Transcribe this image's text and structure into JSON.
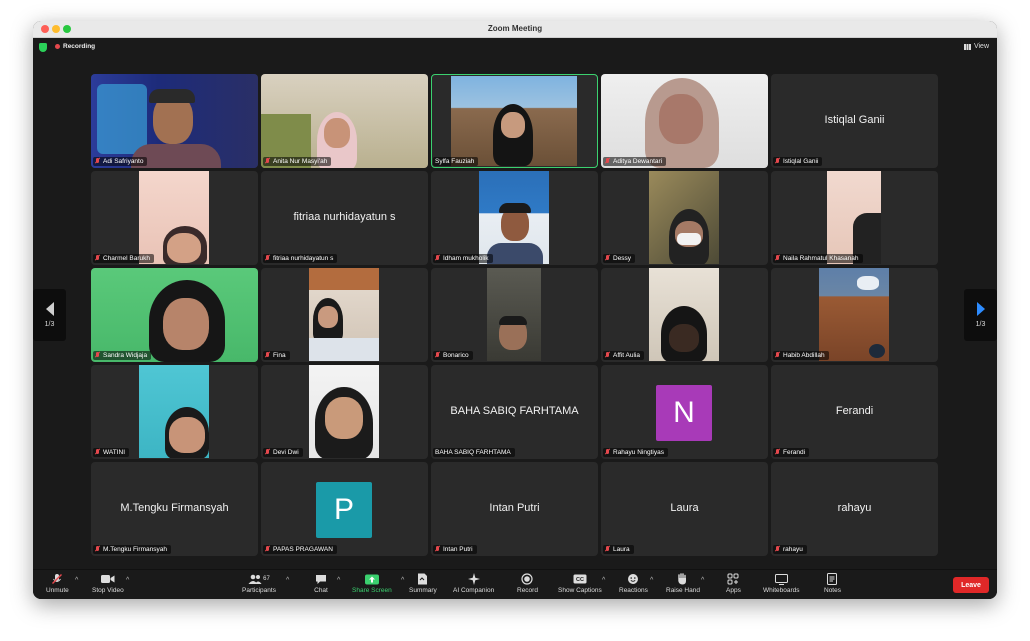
{
  "window": {
    "title": "Zoom Meeting"
  },
  "topbar": {
    "recording_label": "Recording",
    "view_label": "View"
  },
  "pager": {
    "left_label": "1/3",
    "right_label": "1/3"
  },
  "tiles": [
    {
      "name": "Adi Safriyanto",
      "big": ""
    },
    {
      "name": "Anita Nur Masyi'ah",
      "big": ""
    },
    {
      "name": "Sylfa Fauziah",
      "big": ""
    },
    {
      "name": "Aditya Dewantari",
      "big": ""
    },
    {
      "name": "Istiqlal Ganii",
      "big": "Istiqlal Ganii"
    },
    {
      "name": "Charmel Barukh",
      "big": ""
    },
    {
      "name": "fitriaa nurhidayatun s",
      "big": "fitriaa nurhidayatun s"
    },
    {
      "name": "Idham mukholik",
      "big": ""
    },
    {
      "name": "Dessy",
      "big": ""
    },
    {
      "name": "Naila Rahmatul Khasanah",
      "big": ""
    },
    {
      "name": "Sandra Widjaja",
      "big": ""
    },
    {
      "name": "Fina",
      "big": ""
    },
    {
      "name": "Bonarico",
      "big": ""
    },
    {
      "name": "Affit Aulia",
      "big": ""
    },
    {
      "name": "Habib Abdillah",
      "big": ""
    },
    {
      "name": "WATINI",
      "big": ""
    },
    {
      "name": "Devi Dwi",
      "big": ""
    },
    {
      "name": "BAHA SABIQ FARHTAMA",
      "big": "BAHA SABIQ FARHTAMA"
    },
    {
      "name": "Rahayu Ningtiyas",
      "big": "",
      "avatar_letter": "N",
      "avatar_color": "#a83ab8"
    },
    {
      "name": "Ferandi",
      "big": "Ferandi"
    },
    {
      "name": "M.Tengku Firmansyah",
      "big": "M.Tengku Firmansyah"
    },
    {
      "name": "PAPAS PRAGAWAN",
      "big": "",
      "avatar_letter": "P",
      "avatar_color": "#1a9aa8"
    },
    {
      "name": "Intan Putri",
      "big": "Intan Putri"
    },
    {
      "name": "Laura",
      "big": "Laura"
    },
    {
      "name": "rahayu",
      "big": "rahayu"
    }
  ],
  "toolbar": {
    "unmute": "Unmute",
    "stop_video": "Stop Video",
    "participants": "Participants",
    "participants_count": "67",
    "chat": "Chat",
    "share_screen": "Share Screen",
    "summary": "Summary",
    "ai_companion": "AI Companion",
    "record": "Record",
    "show_captions": "Show Captions",
    "reactions": "Reactions",
    "raise_hand": "Raise Hand",
    "apps": "Apps",
    "whiteboards": "Whiteboards",
    "notes": "Notes",
    "leave": "Leave"
  },
  "colors": {
    "accent_green": "#3bd16f",
    "leave_red": "#e02828",
    "pager_blue": "#2d8cff"
  }
}
